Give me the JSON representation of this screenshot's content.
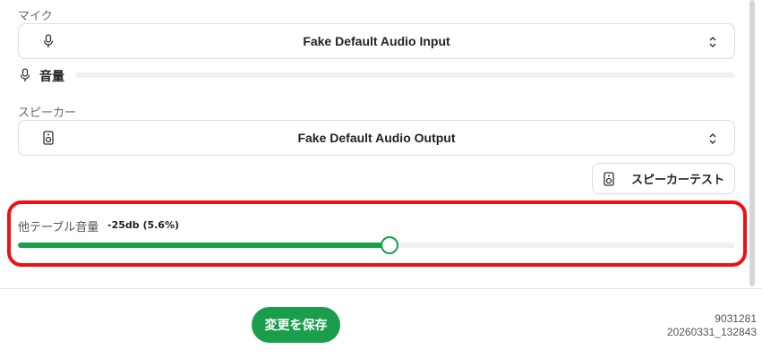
{
  "mic": {
    "label": "マイク",
    "device": "Fake Default Audio Input",
    "icon": "microphone-icon"
  },
  "volume": {
    "label": "音量",
    "icon": "microphone-icon",
    "level": 0
  },
  "speaker": {
    "label": "スピーカー",
    "device": "Fake Default Audio Output",
    "icon": "speaker-icon",
    "test_button": "スピーカーテスト"
  },
  "table_volume": {
    "label": "他テーブル音量",
    "value_text": "-25db (5.6%)",
    "slider_fraction": 0.52
  },
  "save_button": "変更を保存",
  "version": {
    "line1": "9031281",
    "line2": "20260331_132843"
  },
  "colors": {
    "accent": "#1a9e4b",
    "highlight": "#ee1111"
  }
}
